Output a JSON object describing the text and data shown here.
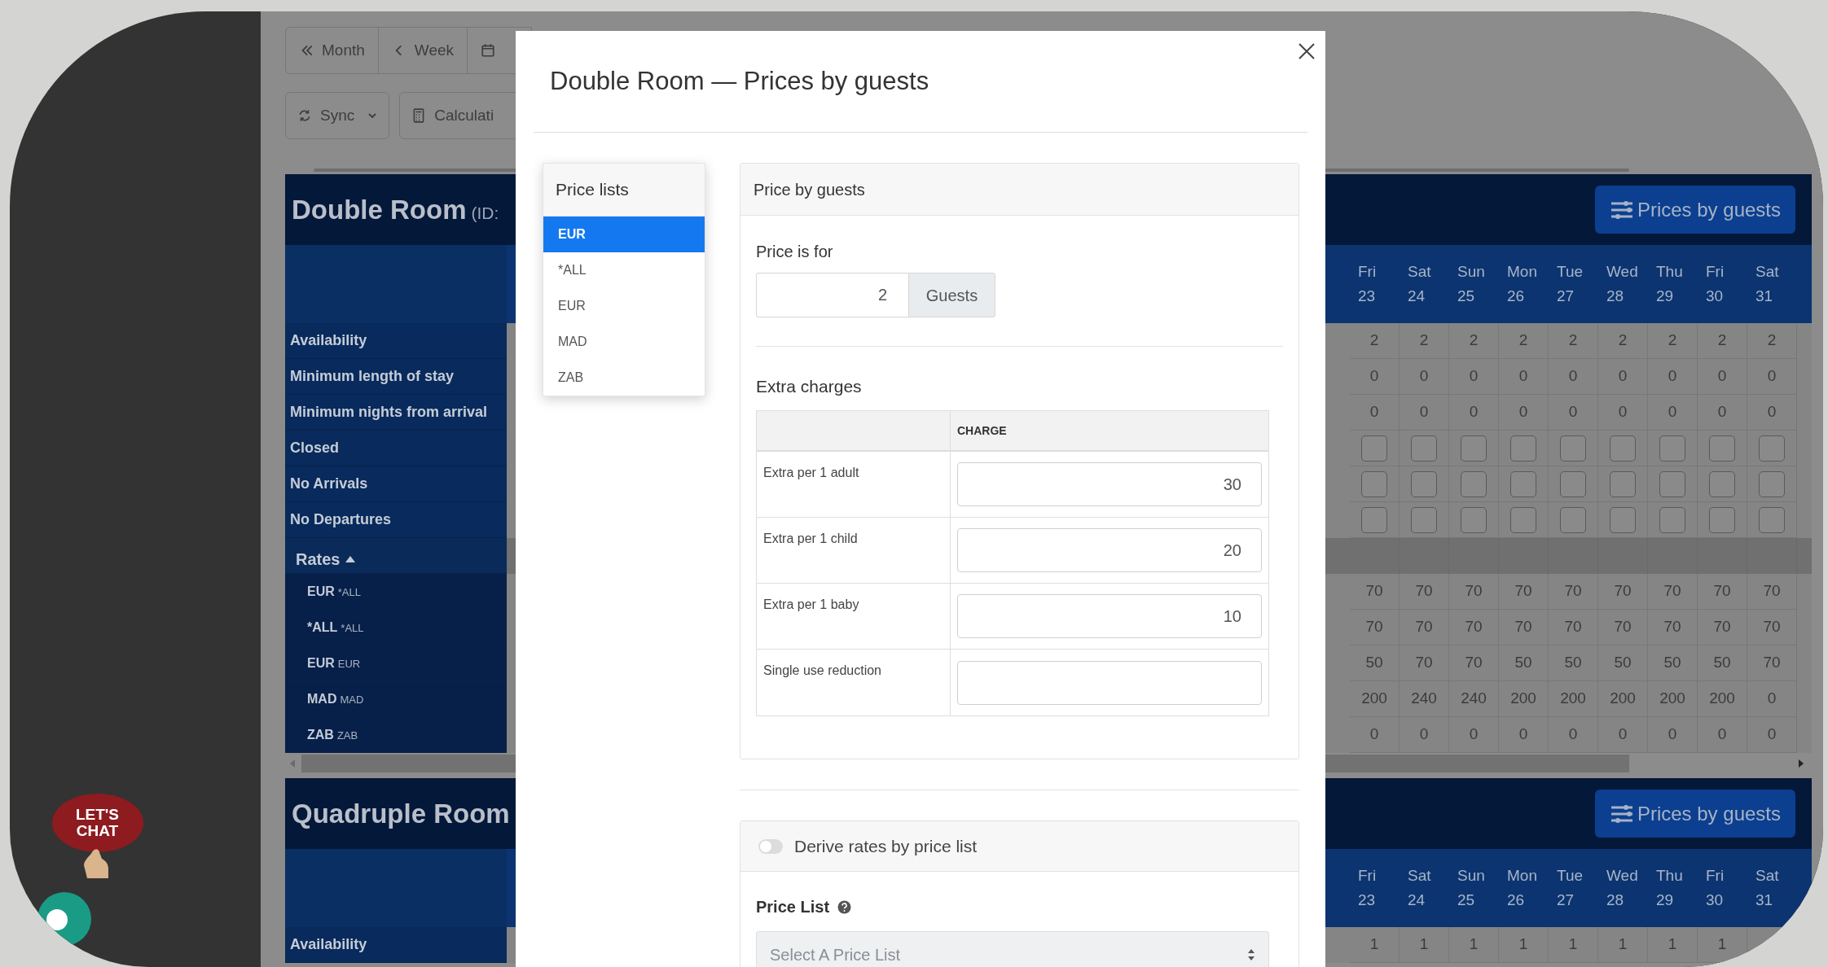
{
  "sidebar": {
    "chat_widget": {
      "label": "LET'S CHAT"
    }
  },
  "toolbar": [
    {
      "kind": "double-left",
      "label": "Month"
    },
    {
      "kind": "left",
      "label": "Week"
    },
    {
      "kind": "calendar"
    }
  ],
  "toolbar_2": [
    {
      "kind": "sync",
      "label": "Sync",
      "dropdown": true
    },
    {
      "kind": "calculator",
      "label": "Calculati"
    }
  ],
  "rooms": [
    {
      "name": "Double Room",
      "id_prefix": "(ID:",
      "button": "Prices by guests",
      "days": [
        {
          "weekday": "Fri",
          "day": "23"
        },
        {
          "weekday": "Sat",
          "day": "24"
        },
        {
          "weekday": "Sun",
          "day": "25"
        },
        {
          "weekday": "Mon",
          "day": "26"
        },
        {
          "weekday": "Tue",
          "day": "27"
        },
        {
          "weekday": "Wed",
          "day": "28"
        },
        {
          "weekday": "Thu",
          "day": "29"
        },
        {
          "weekday": "Fri",
          "day": "30"
        },
        {
          "weekday": "Sat",
          "day": "31"
        }
      ],
      "rows": [
        {
          "label": "Availability",
          "kind": "number",
          "values": [
            "2",
            "2",
            "2",
            "2",
            "2",
            "2",
            "2",
            "2",
            "2"
          ]
        },
        {
          "label": "Minimum length of stay",
          "kind": "number",
          "values": [
            "0",
            "0",
            "0",
            "0",
            "0",
            "0",
            "0",
            "0",
            "0"
          ]
        },
        {
          "label": "Minimum nights from arrival",
          "kind": "number",
          "values": [
            "0",
            "0",
            "0",
            "0",
            "0",
            "0",
            "0",
            "0",
            "0"
          ]
        },
        {
          "label": "Closed",
          "kind": "checkbox",
          "checked": [
            false,
            false,
            false,
            false,
            false,
            false,
            false,
            false,
            false
          ]
        },
        {
          "label": "No Arrivals",
          "kind": "checkbox",
          "checked": [
            false,
            false,
            false,
            false,
            false,
            false,
            false,
            false,
            false
          ]
        },
        {
          "label": "No Departures",
          "kind": "checkbox",
          "checked": [
            false,
            false,
            false,
            false,
            false,
            false,
            false,
            false,
            false
          ]
        }
      ],
      "rates": {
        "label": "Rates",
        "expanded": true,
        "rows": [
          {
            "code": "EUR",
            "list": "*ALL",
            "values": [
              "70",
              "70",
              "70",
              "70",
              "70",
              "70",
              "70",
              "70",
              "70"
            ]
          },
          {
            "code": "*ALL",
            "list": "*ALL",
            "values": [
              "70",
              "70",
              "70",
              "70",
              "70",
              "70",
              "70",
              "70",
              "70"
            ]
          },
          {
            "code": "EUR",
            "list": "EUR",
            "values": [
              "50",
              "70",
              "70",
              "50",
              "50",
              "50",
              "50",
              "50",
              "70"
            ]
          },
          {
            "code": "MAD",
            "list": "MAD",
            "values": [
              "200",
              "240",
              "240",
              "200",
              "200",
              "200",
              "200",
              "200",
              "0"
            ]
          },
          {
            "code": "ZAB",
            "list": "ZAB",
            "values": [
              "0",
              "0",
              "0",
              "0",
              "0",
              "0",
              "0",
              "0",
              "0"
            ]
          }
        ]
      }
    },
    {
      "name": "Quadruple Room",
      "button": "Prices by guests",
      "days": [
        {
          "weekday": "Fri",
          "day": "23"
        },
        {
          "weekday": "Sat",
          "day": "24"
        },
        {
          "weekday": "Sun",
          "day": "25"
        },
        {
          "weekday": "Mon",
          "day": "26"
        },
        {
          "weekday": "Tue",
          "day": "27"
        },
        {
          "weekday": "Wed",
          "day": "28"
        },
        {
          "weekday": "Thu",
          "day": "29"
        },
        {
          "weekday": "Fri",
          "day": "30"
        },
        {
          "weekday": "Sat",
          "day": "31"
        }
      ],
      "rows": [
        {
          "label": "Availability",
          "kind": "number",
          "values": [
            "1",
            "1",
            "1",
            "1",
            "1",
            "1",
            "1",
            "1"
          ]
        }
      ]
    }
  ],
  "modal": {
    "title": "Double Room — Prices by guests",
    "price_lists": {
      "title": "Price lists",
      "items": [
        {
          "label": "EUR",
          "selected": true
        },
        {
          "label": "*ALL",
          "selected": false
        },
        {
          "label": "EUR",
          "selected": false
        },
        {
          "label": "MAD",
          "selected": false
        },
        {
          "label": "ZAB",
          "selected": false
        }
      ]
    },
    "price_by_guests": {
      "title": "Price by guests",
      "price_is_for": {
        "label": "Price is for",
        "value": "2",
        "addon": "Guests"
      },
      "extra_charges": {
        "title": "Extra charges",
        "column": "CHARGE",
        "rows": [
          {
            "label": "Extra per 1 adult",
            "value": "30"
          },
          {
            "label": "Extra per 1 child",
            "value": "20"
          },
          {
            "label": "Extra per 1 baby",
            "value": "10"
          },
          {
            "label": "Single use reduction"
          }
        ]
      }
    },
    "derive": {
      "label": "Derive rates by price list",
      "on": false,
      "price_list": {
        "label": "Price List",
        "placeholder": "Select A Price List"
      }
    }
  }
}
